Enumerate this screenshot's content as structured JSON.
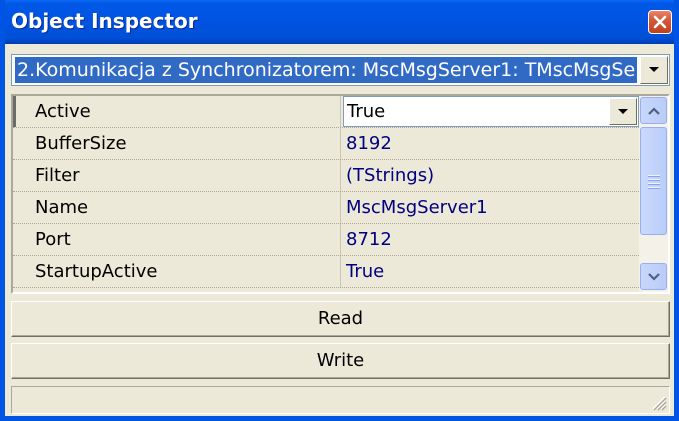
{
  "window": {
    "title": "Object Inspector"
  },
  "selector": {
    "value": "2.Komunikacja z Synchronizatorem: MscMsgServer1: TMscMsgSe"
  },
  "properties": [
    {
      "name": "Active",
      "value": "True"
    },
    {
      "name": "BufferSize",
      "value": "8192"
    },
    {
      "name": "Filter",
      "value": "(TStrings)"
    },
    {
      "name": "Name",
      "value": "MscMsgServer1"
    },
    {
      "name": "Port",
      "value": "8712"
    },
    {
      "name": "StartupActive",
      "value": "True"
    }
  ],
  "buttons": {
    "read_label": "Read",
    "write_label": "Write"
  },
  "icons": {
    "close": "close-icon",
    "dropdown": "chevron-down-icon",
    "scroll_up": "arrow-up-icon",
    "scroll_down": "arrow-down-icon",
    "grip": "resize-grip-icon"
  },
  "colors": {
    "titlebar": "#0054e3",
    "selection": "#316ac5",
    "value_text": "#000080",
    "face": "#ece9d8"
  }
}
